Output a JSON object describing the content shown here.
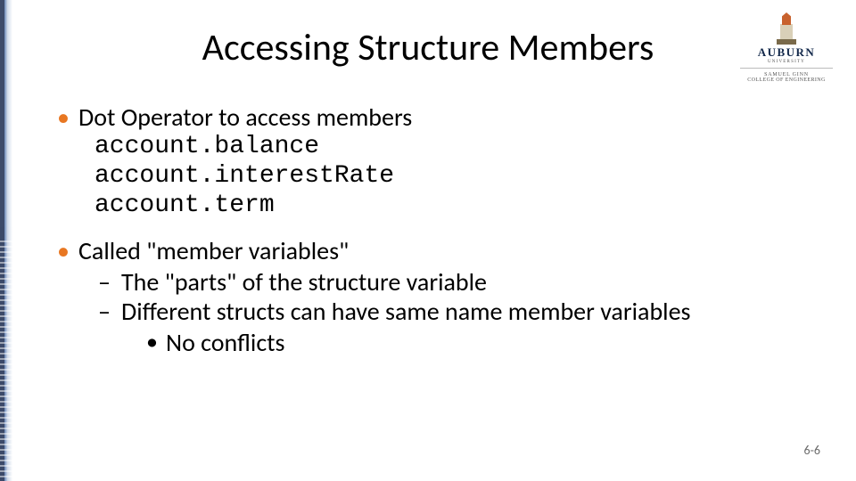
{
  "logo": {
    "name": "AUBURN",
    "university": "UNIVERSITY",
    "sub1": "SAMUEL GINN",
    "sub2": "COLLEGE OF ENGINEERING"
  },
  "title": "Accessing Structure Members",
  "bullets": [
    {
      "text": "Dot Operator to access members",
      "code": [
        "account.balance",
        "account.interestRate",
        "account.term"
      ]
    },
    {
      "text": "Called \"member variables\"",
      "sub": [
        {
          "text": "The \"parts\" of the structure variable"
        },
        {
          "text": "Different structs can have same name member variables",
          "sub": [
            {
              "text": "No conflicts"
            }
          ]
        }
      ]
    }
  ],
  "pagenum": "6-6"
}
